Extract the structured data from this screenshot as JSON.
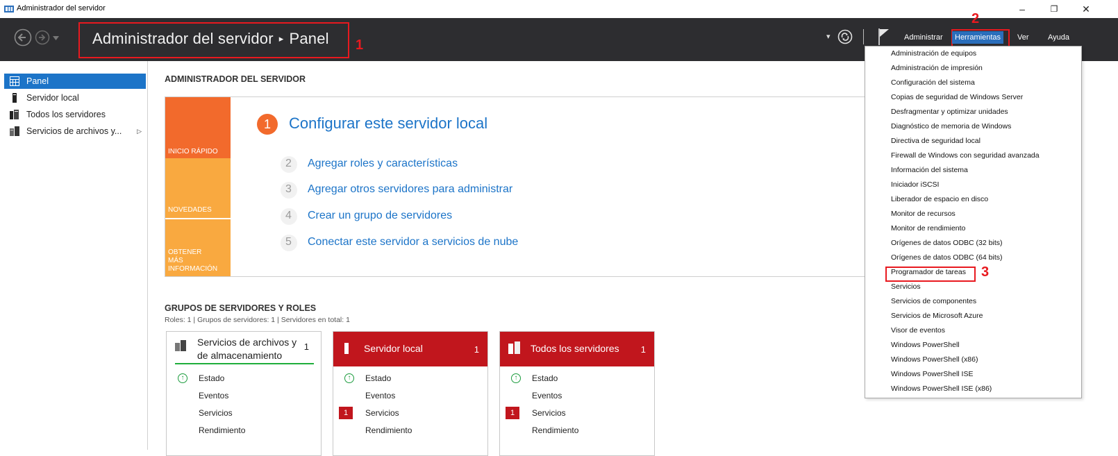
{
  "window": {
    "title": "Administrador del servidor",
    "minimize": "–",
    "restore": "❐",
    "close": "✕"
  },
  "header": {
    "breadcrumb_app": "Administrador del servidor",
    "breadcrumb_sep": "▸",
    "breadcrumb_page": "Panel",
    "refresh_dropdown": "▾",
    "menu": {
      "manage": "Administrar",
      "tools": "Herramientas",
      "view": "Ver",
      "help": "Ayuda"
    }
  },
  "annotations": [
    "1",
    "2",
    "3"
  ],
  "sidebar": {
    "items": [
      {
        "label": "Panel",
        "icon": "dashboard-icon"
      },
      {
        "label": "Servidor local",
        "icon": "server-icon"
      },
      {
        "label": "Todos los servidores",
        "icon": "servers-icon"
      },
      {
        "label": "Servicios de archivos y...",
        "icon": "file-services-icon"
      }
    ]
  },
  "main": {
    "welcome_title": "ADMINISTRADOR DEL SERVIDOR",
    "quick_start": {
      "tabs": [
        "INICIO RÁPIDO",
        "NOVEDADES",
        "OBTENER MÁS INFORMACIÓN"
      ],
      "step1_number": "1",
      "step1_label": "Configurar este servidor local",
      "steps": [
        {
          "number": "2",
          "label": "Agregar roles y características"
        },
        {
          "number": "3",
          "label": "Agregar otros servidores para administrar"
        },
        {
          "number": "4",
          "label": "Crear un grupo de servidores"
        },
        {
          "number": "5",
          "label": "Conectar este servidor a servicios de nube"
        }
      ]
    },
    "groups_title": "GRUPOS DE SERVIDORES Y ROLES",
    "groups_subtitle": "Roles: 1   |   Grupos de servidores: 1   |   Servidores en total: 1",
    "cards": [
      {
        "title_line1": "Servicios de archivos y",
        "title_line2": "de almacenamiento",
        "count": "1",
        "rows": [
          "Estado",
          "Eventos",
          "Servicios",
          "Rendimiento"
        ],
        "status_icon": "↑"
      },
      {
        "title": "Servidor local",
        "count": "1",
        "rows": [
          "Estado",
          "Eventos",
          "Servicios",
          "Rendimiento"
        ],
        "status_icon": "↑",
        "badge": "1"
      },
      {
        "title": "Todos los servidores",
        "count": "1",
        "rows": [
          "Estado",
          "Eventos",
          "Servicios",
          "Rendimiento"
        ],
        "status_icon": "↑",
        "badge": "1"
      }
    ]
  },
  "tools_menu": {
    "items": [
      "Administración de equipos",
      "Administración de impresión",
      "Configuración del sistema",
      "Copias de seguridad de Windows Server",
      "Desfragmentar y optimizar unidades",
      "Diagnóstico de memoria de Windows",
      "Directiva de seguridad local",
      "Firewall de Windows con seguridad avanzada",
      "Información del sistema",
      "Iniciador iSCSI",
      "Liberador de espacio en disco",
      "Monitor de recursos",
      "Monitor de rendimiento",
      "Orígenes de datos ODBC (32 bits)",
      "Orígenes de datos ODBC (64 bits)",
      "Programador de tareas",
      "Servicios",
      "Servicios de componentes",
      "Servicios de Microsoft Azure",
      "Visor de eventos",
      "Windows PowerShell",
      "Windows PowerShell (x86)",
      "Windows PowerShell ISE",
      "Windows PowerShell ISE (x86)"
    ]
  },
  "colors": {
    "header_bg": "#2d2d30",
    "accent_blue": "#1c74c8",
    "quick_start_orange": "#f26a2c",
    "quick_start_light_orange": "#f9a940",
    "tile_red": "#c1161d",
    "annotation_red": "#e8191f"
  }
}
